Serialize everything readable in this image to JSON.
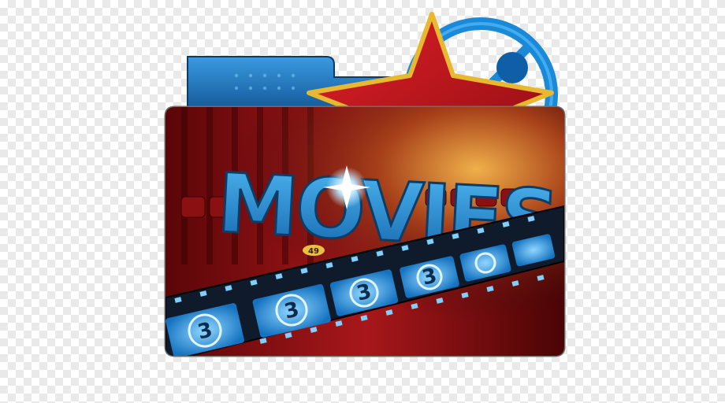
{
  "icon": {
    "name": "Movies folder icon",
    "title_text": "MOVIES",
    "seat_number": "49",
    "frame_number": "3"
  },
  "colors": {
    "folder_back": "#1f6fb0",
    "star": "#c8141a",
    "star_border": "#e8b830",
    "film_reel": "#1a8ad8",
    "curtain": "#7a0d10",
    "title_blue": "#1e8fd6",
    "film_strip": "#0f1b2a",
    "film_frame": "#2aa6ee"
  }
}
